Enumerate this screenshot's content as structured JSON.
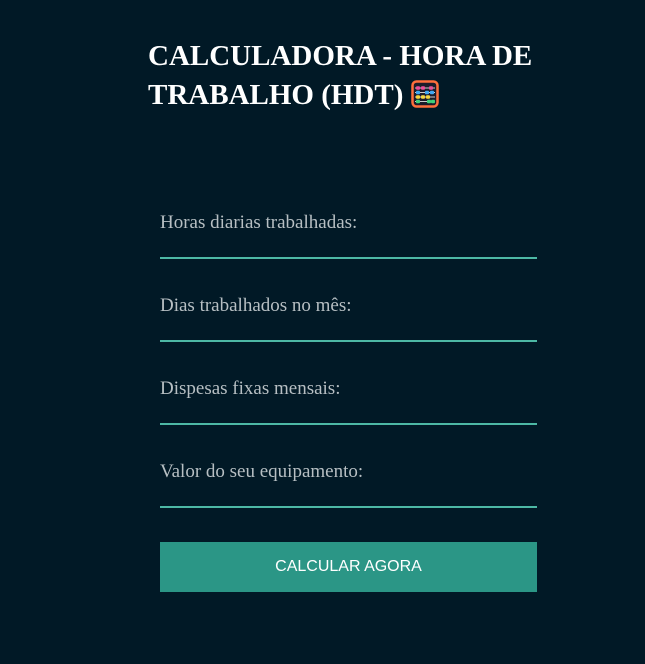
{
  "header": {
    "title": "CALCULADORA - HORA DE TRABALHO (HDT)",
    "title_icon": "abacus-icon"
  },
  "form": {
    "fields": [
      {
        "label": "Horas diarias trabalhadas:",
        "value": ""
      },
      {
        "label": "Dias trabalhados no mês:",
        "value": ""
      },
      {
        "label": "Dispesas fixas mensais:",
        "value": ""
      },
      {
        "label": "Valor do seu equipamento:",
        "value": ""
      }
    ],
    "submit_label": "CALCULAR AGORA"
  },
  "colors": {
    "background": "#011926",
    "accent": "#4db8a5",
    "button": "#2b9686",
    "label": "#b7bfc3",
    "title": "#ffffff"
  }
}
